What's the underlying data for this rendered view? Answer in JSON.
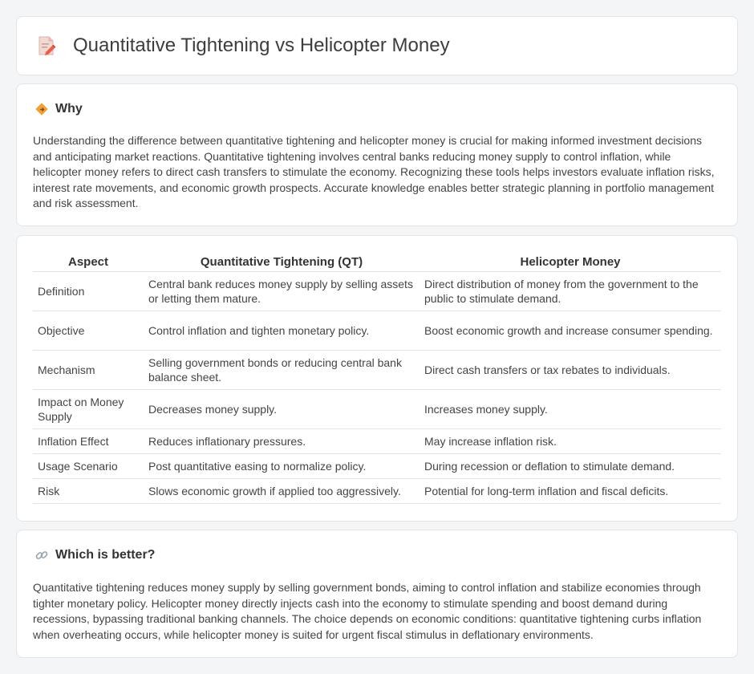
{
  "header": {
    "title": "Quantitative Tightening vs Helicopter Money",
    "icon": "document-edit-icon"
  },
  "why": {
    "heading": "Why",
    "icon": "diamond-signal-icon",
    "body": "Understanding the difference between quantitative tightening and helicopter money is crucial for making informed investment decisions and anticipating market reactions. Quantitative tightening involves central banks reducing money supply to control inflation, while helicopter money refers to direct cash transfers to stimulate the economy. Recognizing these tools helps investors evaluate inflation risks, interest rate movements, and economic growth prospects. Accurate knowledge enables better strategic planning in portfolio management and risk assessment."
  },
  "comparison": {
    "headers": [
      "Aspect",
      "Quantitative Tightening (QT)",
      "Helicopter Money"
    ],
    "rows": [
      [
        "Definition",
        "Central bank reduces money supply by selling assets or letting them mature.",
        "Direct distribution of money from the government to the public to stimulate demand."
      ],
      [
        "Objective",
        "Control inflation and tighten monetary policy.",
        "Boost economic growth and increase consumer spending."
      ],
      [
        "Mechanism",
        "Selling government bonds or reducing central bank balance sheet.",
        "Direct cash transfers or tax rebates to individuals."
      ],
      [
        "Impact on Money Supply",
        "Decreases money supply.",
        "Increases money supply."
      ],
      [
        "Inflation Effect",
        "Reduces inflationary pressures.",
        "May increase inflation risk."
      ],
      [
        "Usage Scenario",
        "Post quantitative easing to normalize policy.",
        "During recession or deflation to stimulate demand."
      ],
      [
        "Risk",
        "Slows economic growth if applied too aggressively.",
        "Potential for long-term inflation and fiscal deficits."
      ]
    ]
  },
  "better": {
    "heading": "Which is better?",
    "icon": "link-icon",
    "body": "Quantitative tightening reduces money supply by selling government bonds, aiming to control inflation and stabilize economies through tighter monetary policy. Helicopter money directly injects cash into the economy to stimulate spending and boost demand during recessions, bypassing traditional banking channels. The choice depends on economic conditions: quantitative tightening curbs inflation when overheating occurs, while helicopter money is suited for urgent fiscal stimulus in deflationary environments."
  },
  "colors": {
    "background": "#f4f5f7",
    "card": "#ffffff",
    "border": "#e3e5e8",
    "icon_accent": "#f0a13a",
    "icon_edit": "#e8604a"
  }
}
